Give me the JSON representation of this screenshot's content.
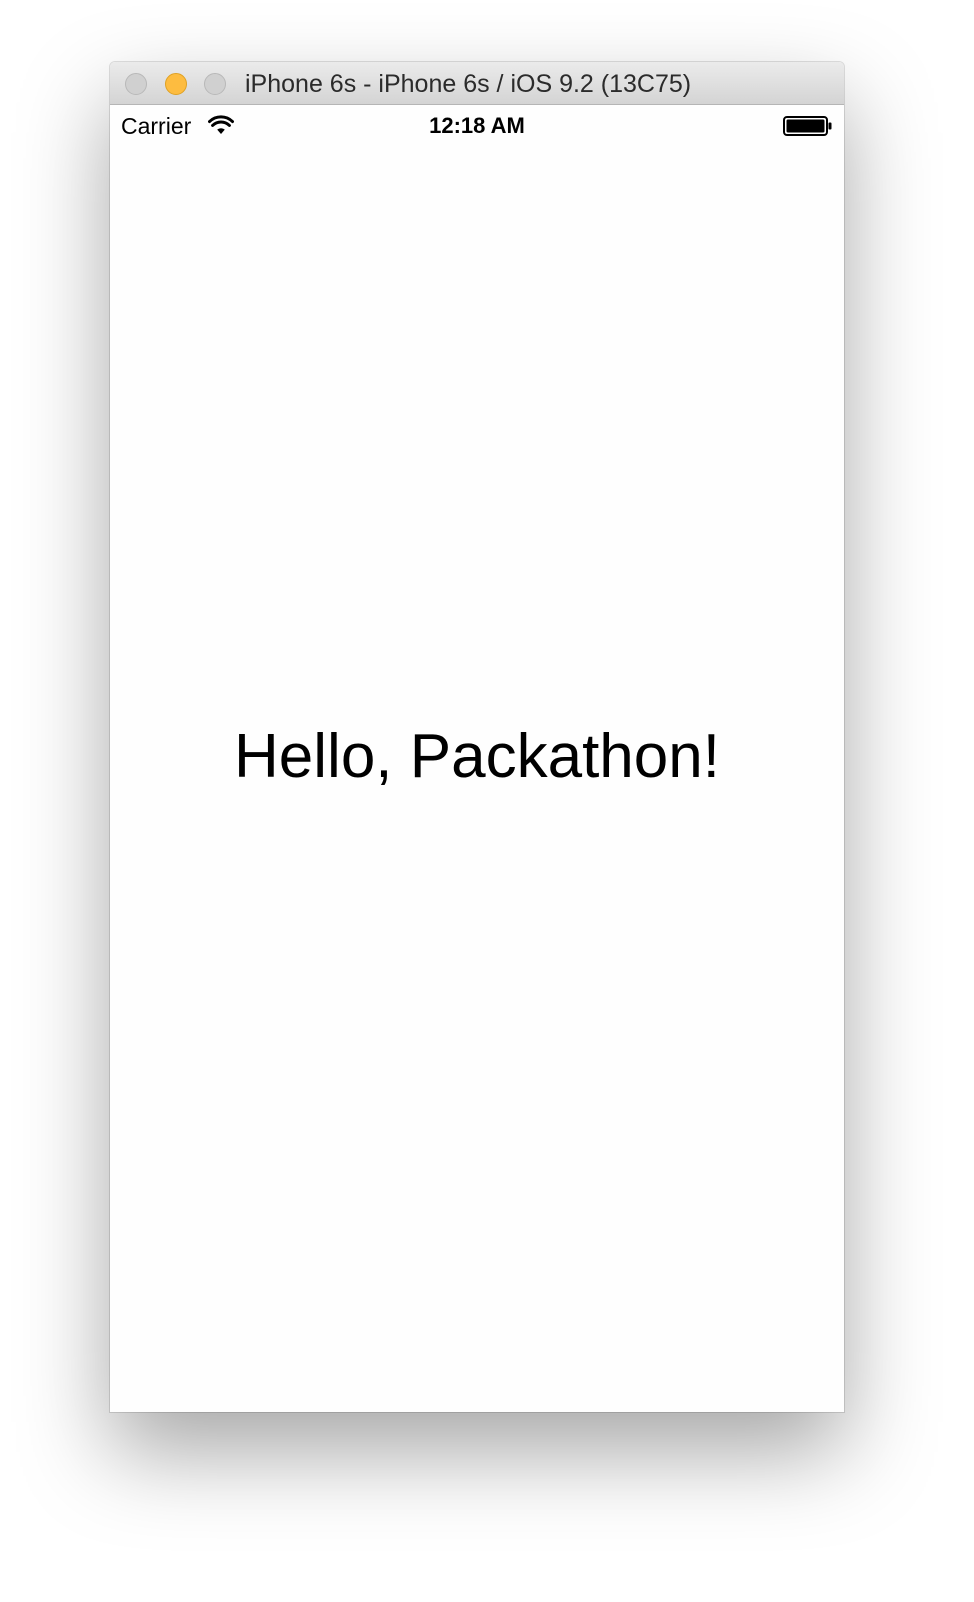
{
  "window": {
    "title": "iPhone 6s - iPhone 6s / iOS 9.2 (13C75)",
    "buttons": [
      "close",
      "minimize",
      "zoom"
    ]
  },
  "status_bar": {
    "carrier": "Carrier",
    "time": "12:18 AM",
    "icons": [
      "wifi-icon",
      "battery-icon"
    ]
  },
  "content": {
    "label": "Hello, Packathon!"
  },
  "colors": {
    "minimize_button": "#fdbc40",
    "inactive_button": "#d0d0d0",
    "screen_background": "#fefefe",
    "text": "#000000"
  }
}
